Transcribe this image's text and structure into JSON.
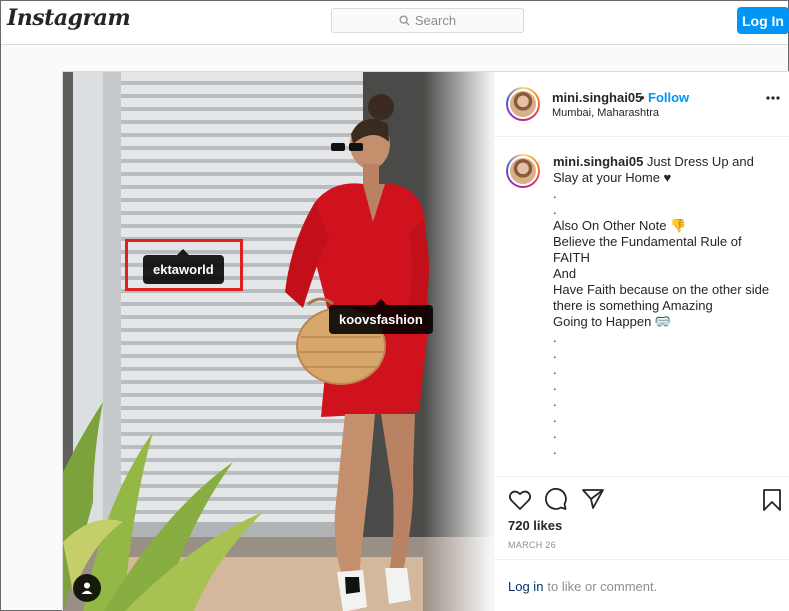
{
  "header": {
    "logo": "Instagram",
    "search_placeholder": "Search",
    "login_label": "Log In"
  },
  "post": {
    "username": "mini.singhai05",
    "separator": "•",
    "follow_label": "Follow",
    "location": "Mumbai, Maharashtra",
    "caption_user": "mini.singhai05",
    "caption_lines": [
      " Just Dress Up and Slay at your Home ♥",
      ".",
      ".",
      "Also On Other Note 👎",
      "Believe the Fundamental Rule of FAITH",
      "And",
      "Have Faith because on the other side there is something Amazing",
      "Going to Happen 🥽",
      ".",
      ".",
      ".",
      ".",
      ".",
      ".",
      ".",
      "."
    ],
    "likes": "720 likes",
    "date": "MARCH 26",
    "login_link": "Log in",
    "login_prompt": "to like or comment."
  },
  "tags": {
    "tag1": "ektaworld",
    "tag2": "koovsfashion"
  },
  "icons": {
    "search": "search-icon",
    "more": "more-options-icon",
    "like": "heart-icon",
    "comment": "comment-icon",
    "share": "share-icon",
    "save": "bookmark-icon",
    "user_tags": "user-tag-icon"
  },
  "colors": {
    "accent": "#0095f6",
    "highlight": "#e02020",
    "dress": "#d0121e"
  }
}
